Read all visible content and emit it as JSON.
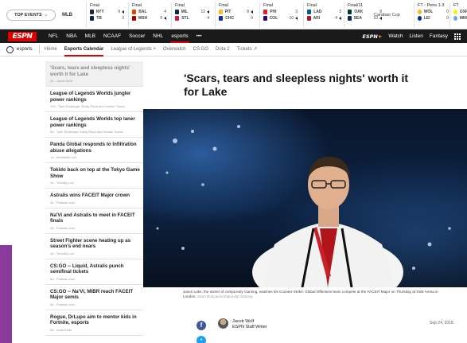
{
  "scorebar": {
    "top_events_label": "TOP EVENTS",
    "league": "MLB",
    "games": [
      {
        "status": "Final",
        "teams": [
          {
            "abbr": "NYY",
            "score": "9",
            "color": "#1c2841",
            "winner": true
          },
          {
            "abbr": "TB",
            "score": "3",
            "color": "#0a2351",
            "winner": false
          }
        ]
      },
      {
        "status": "Final",
        "teams": [
          {
            "abbr": "BAL",
            "score": "4",
            "color": "#df4601",
            "winner": false
          },
          {
            "abbr": "WSH",
            "score": "9",
            "color": "#ab0003",
            "winner": true
          }
        ]
      },
      {
        "status": "Final",
        "teams": [
          {
            "abbr": "MIL",
            "score": "12",
            "color": "#12284b",
            "winner": true
          },
          {
            "abbr": "STL",
            "score": "4",
            "color": "#c41e3a",
            "winner": false
          }
        ]
      },
      {
        "status": "Final",
        "teams": [
          {
            "abbr": "PIT",
            "score": "8",
            "color": "#fdb827",
            "winner": true
          },
          {
            "abbr": "CHC",
            "score": "0",
            "color": "#0e3386",
            "winner": false
          }
        ]
      },
      {
        "status": "Final",
        "teams": [
          {
            "abbr": "PHI",
            "score": "3",
            "color": "#e81828",
            "winner": false
          },
          {
            "abbr": "COL",
            "score": "10",
            "color": "#33006f",
            "winner": true
          }
        ]
      },
      {
        "status": "Final",
        "teams": [
          {
            "abbr": "LAD",
            "score": "3",
            "color": "#005a9c",
            "winner": false
          },
          {
            "abbr": "ARI",
            "score": "4",
            "color": "#a71930",
            "winner": true
          }
        ]
      },
      {
        "status": "Final/11",
        "teams": [
          {
            "abbr": "OAK",
            "score": "8",
            "color": "#003831",
            "winner": false
          },
          {
            "abbr": "SEA",
            "score": "10",
            "color": "#0c2c56",
            "winner": true
          }
        ]
      }
    ],
    "event_label": "Carabao Cup",
    "soccer": [
      {
        "status": "FT - Pens 1-3",
        "teams": [
          {
            "abbr": "WOL",
            "score": "0",
            "color": "#fdb913"
          },
          {
            "abbr": "LEI",
            "score": "0",
            "color": "#003090"
          }
        ]
      },
      {
        "status": "FT",
        "teams": [
          {
            "abbr": "OXF",
            "score": "",
            "color": "#fff200"
          },
          {
            "abbr": "MNC",
            "score": "",
            "color": "#6cabdd"
          }
        ]
      }
    ]
  },
  "mainnav": {
    "logo": "ESPN",
    "links": [
      "NFL",
      "NBA",
      "MLB",
      "NCAAF",
      "Soccer",
      "NHL",
      "esports",
      "•••"
    ],
    "active": "esports",
    "plus_logo": "ESPN",
    "plus_mark": "+",
    "right_links": [
      "Watch",
      "Listen",
      "Fantasy"
    ]
  },
  "subnav": {
    "sport": "esports",
    "links": [
      "Home",
      "Esports Calendar",
      "League of Legends +",
      "Overwatch",
      "CS:GO",
      "Dota 2",
      "Tickets ↗"
    ],
    "active": "Esports Calendar"
  },
  "sidebar": {
    "stories": [
      {
        "headline": "'Scars, tears and sleepless nights' worth it for Lake",
        "meta": "3d - Jacob Wolf"
      },
      {
        "headline": "League of Legends Worlds jungler power rankings",
        "meta": "10h - Tyler Erzberger, Emily Rand and Xander Torres"
      },
      {
        "headline": "League of Legends Worlds top laner power rankings",
        "meta": "5d - Tyler Erzberger, Emily Rand and Xander Torres"
      },
      {
        "headline": "Panda Global responds to Infiltration abuse allegations",
        "meta": "1d - Alexander Lee"
      },
      {
        "headline": "Tokido back on top at the Tokyo Game Show",
        "meta": "2d - Timothy Lee"
      },
      {
        "headline": "Astralis wins FACEIT Major crown",
        "meta": "3d - Polsean.com"
      },
      {
        "headline": "Na'Vi and Astralis to meet in FACEIT finals",
        "meta": "4d - Polsean.com"
      },
      {
        "headline": "Street Fighter scene heating up as season's end nears",
        "meta": "4d - Timothy Lee"
      },
      {
        "headline": "CS:GO -- Liquid, Astralis punch semifinal tickets",
        "meta": "5d - Polsean.com"
      },
      {
        "headline": "CS:GO -- Na'Vi, MIBR reach FACEIT Major semis",
        "meta": "5d - Polsean.com"
      },
      {
        "headline": "Rogue, DrLupo aim to mentor kids in Fortnite, esports",
        "meta": "5d - Imad Khan"
      }
    ]
  },
  "article": {
    "headline": "'Scars, tears and sleepless nights' worth it for Lake",
    "caption": "Jason Lake, the owner of compLexity Gaming, watches his Counter-Strike: Global Offensive team compete at the FACEIT Major on Thursday at SSE Arena in London.",
    "caption_credit": "Sean Duncan/compLexity Gaming",
    "author_name": "Jacob Wolf",
    "author_title": "ESPN Staff Writer",
    "date": "Sep 24, 2018",
    "fb_glyph": "f",
    "tw_glyph": "•"
  },
  "colors": {
    "espn_red": "#d00",
    "nav_bg": "#1a1a1a",
    "accent_purple": "#8a3a9c"
  }
}
